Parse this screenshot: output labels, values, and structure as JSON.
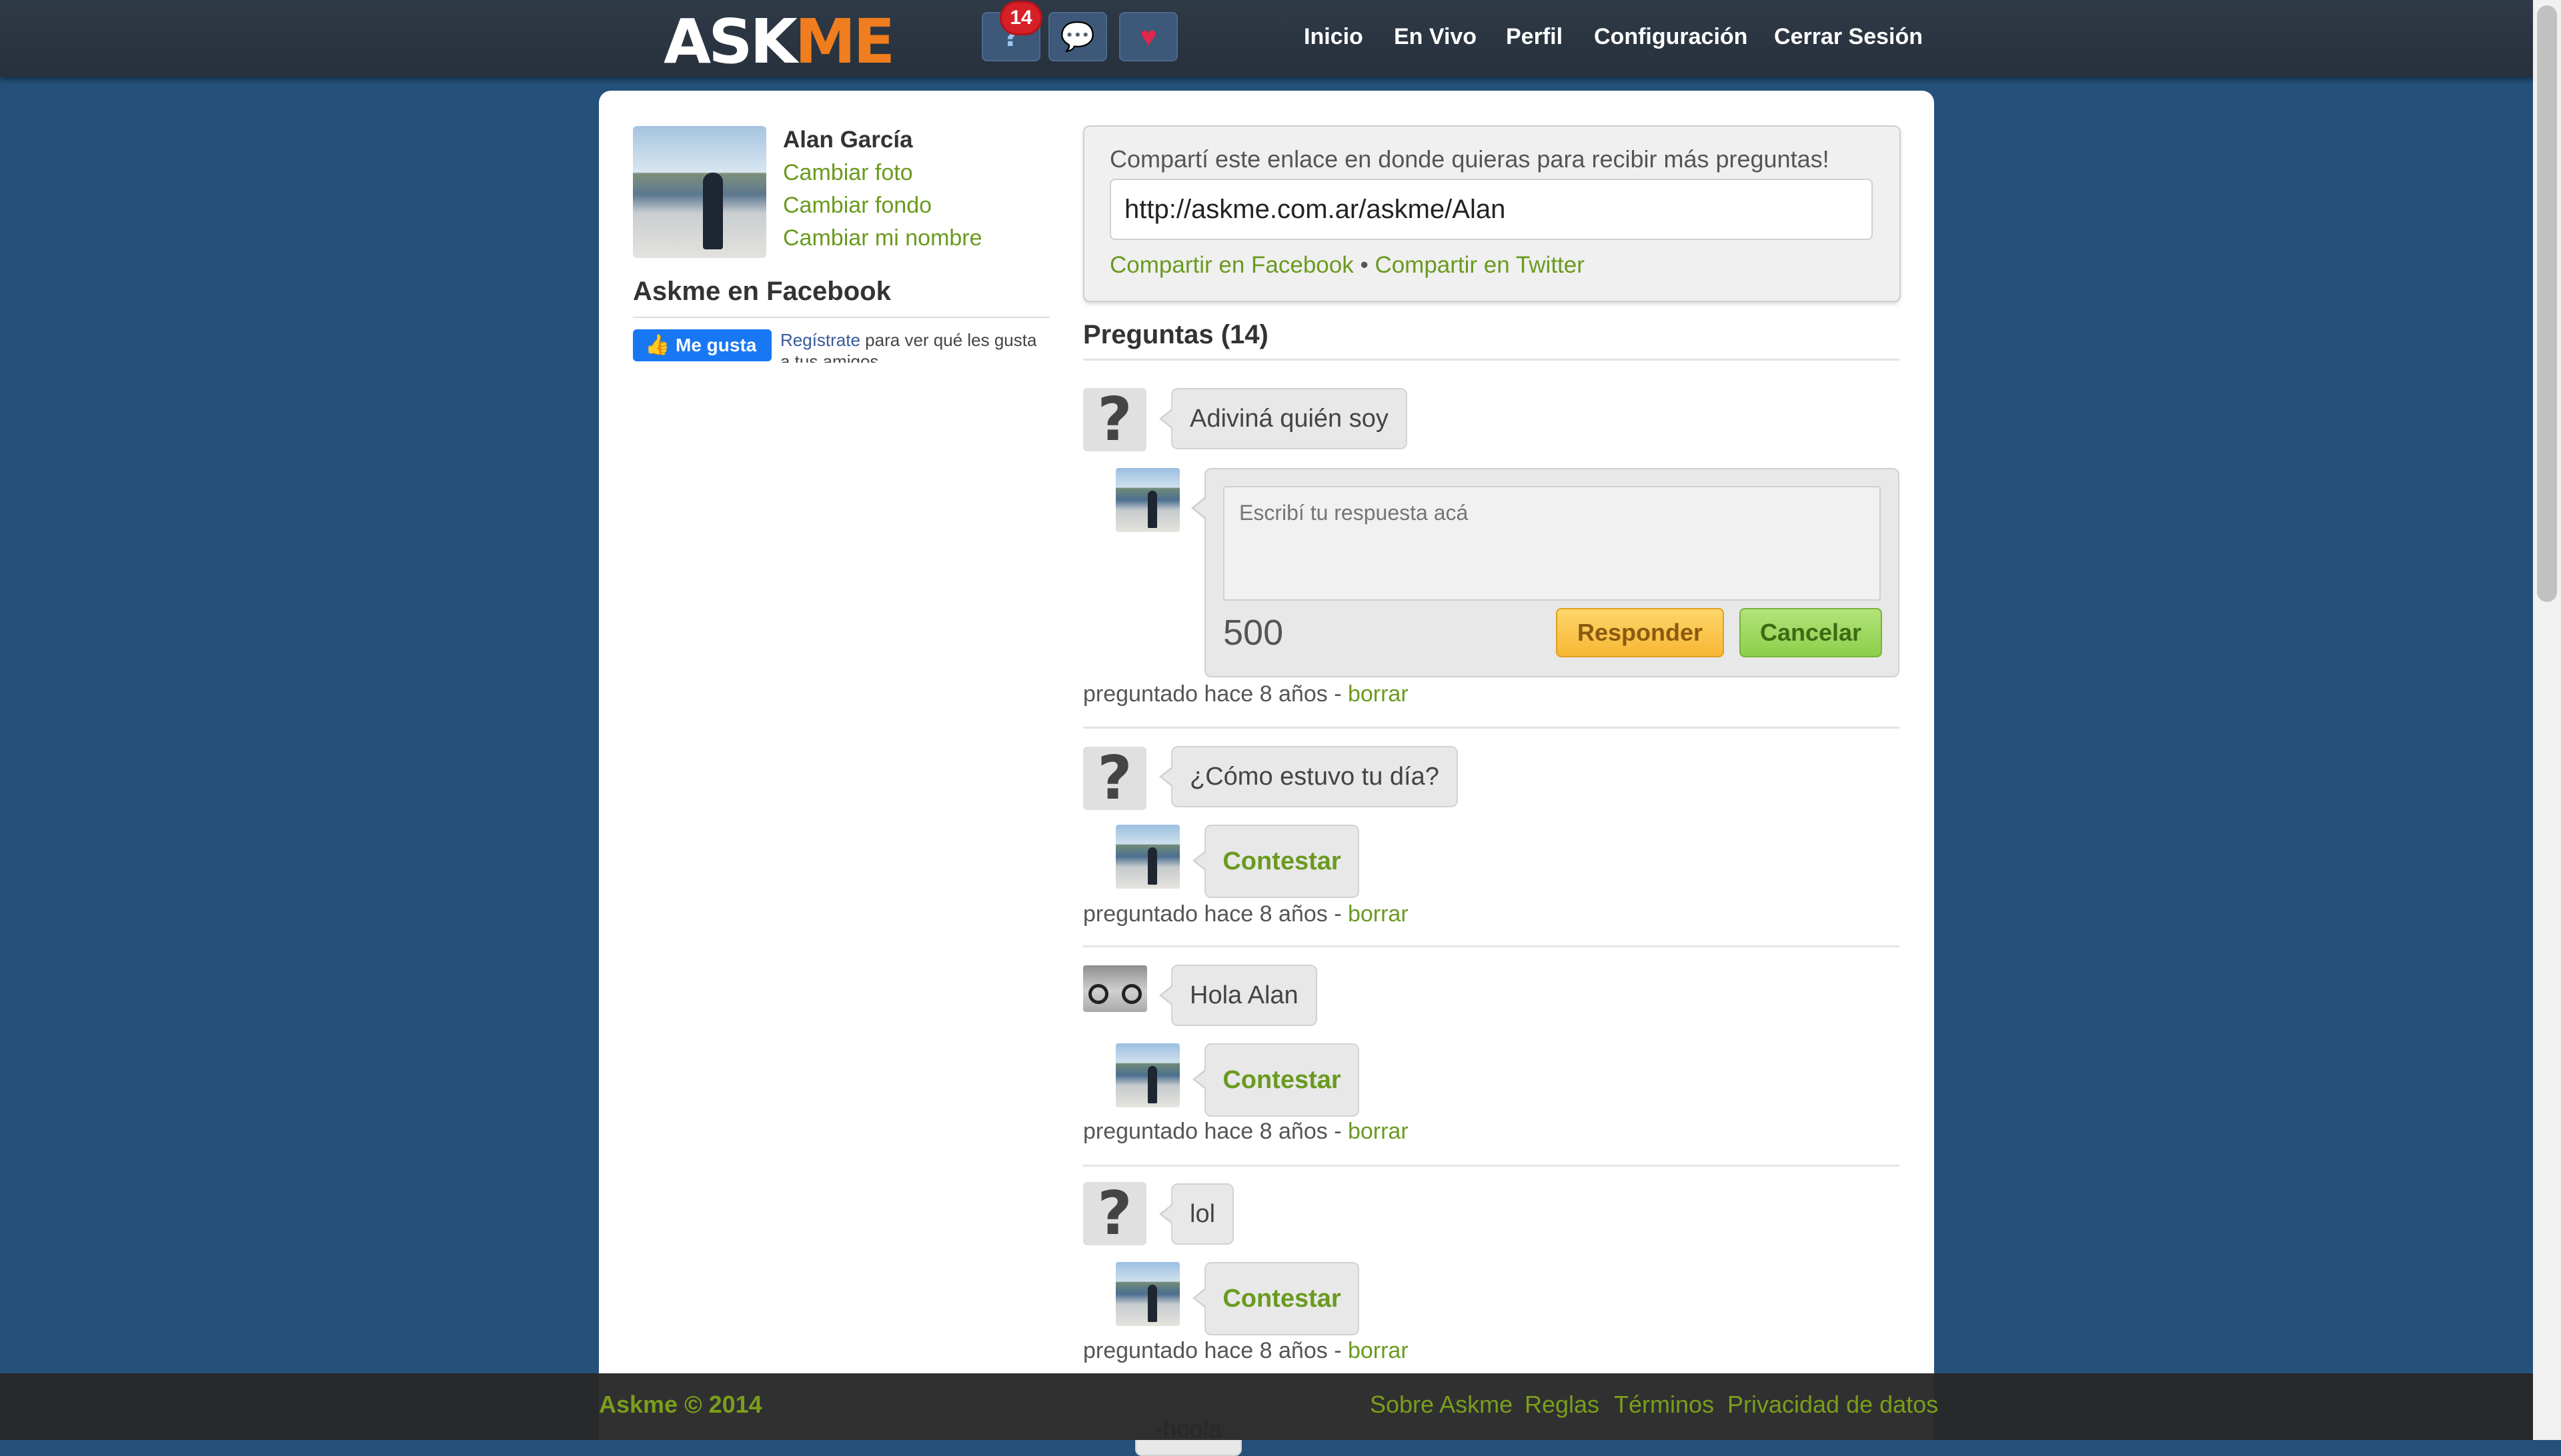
{
  "brand": {
    "logo_part1": "ASK",
    "logo_part2": "ME"
  },
  "topbar": {
    "notifications_count": "14",
    "nav": [
      "Inicio",
      "En Vivo",
      "Perfil",
      "Configuración",
      "Cerrar Sesión"
    ],
    "colors": {
      "bar": "#2f3a47",
      "logo_accent": "#f07d1e",
      "badge": "#d71f27"
    }
  },
  "profile": {
    "name": "Alan García",
    "links": [
      "Cambiar foto",
      "Cambiar fondo",
      "Cambiar mi nombre"
    ]
  },
  "sidebar": {
    "facebook_title": "Askme en Facebook",
    "like_label": "Me gusta",
    "register_link": "Regístrate",
    "register_text": " para ver qué les gusta a tus amigos."
  },
  "share": {
    "prompt": "Compartí este enlace en donde quieras para recibir más preguntas!",
    "url": "http://askme.com.ar/askme/Alan",
    "facebook": "Compartir en Facebook",
    "separator": " • ",
    "twitter": "Compartir en Twitter"
  },
  "questions_heading": "Preguntas (14)",
  "answer_form": {
    "placeholder": "Escribí tu respuesta acá",
    "counter": "500",
    "submit": "Responder",
    "cancel": "Cancelar"
  },
  "questions": [
    {
      "text": "Adiviná quién soy",
      "meta": "preguntado hace 8 años - ",
      "delete": "borrar"
    },
    {
      "text": "¿Cómo estuvo tu día?",
      "action": "Contestar",
      "meta": "preguntado hace 8 años - ",
      "delete": "borrar"
    },
    {
      "text": "Hola Alan",
      "action": "Contestar",
      "meta": "preguntado hace 8 años - ",
      "delete": "borrar"
    },
    {
      "text": "lol",
      "action": "Contestar",
      "meta": "preguntado hace 8 años - ",
      "delete": "borrar"
    },
    {
      "text": "-hoola"
    }
  ],
  "footer": {
    "copyright": "Askme © 2014",
    "links": [
      "Sobre Askme",
      "Reglas",
      "Términos",
      "Privacidad de datos"
    ]
  }
}
